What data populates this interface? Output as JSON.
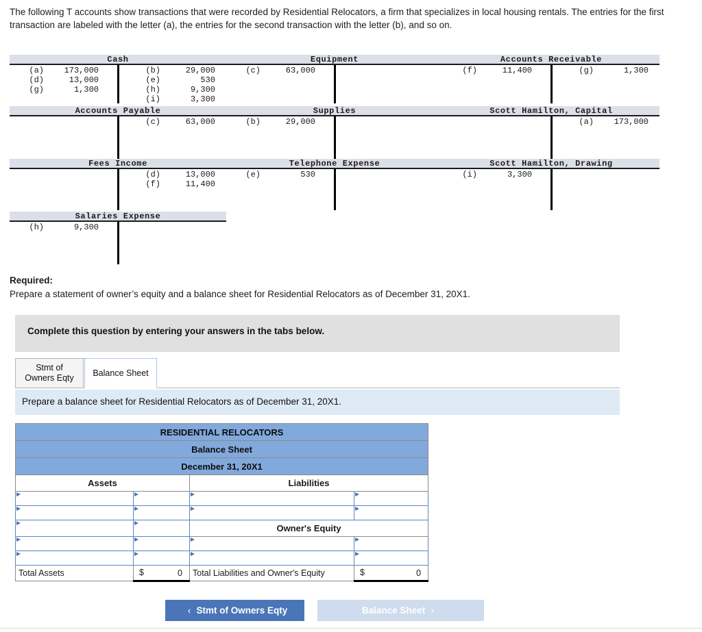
{
  "intro": {
    "text": "The following T accounts show transactions that were recorded by Residential Relocators, a firm that specializes in local housing rentals. The entries for the first transaction are labeled with the letter (a), the entries for the second transaction with the letter (b), and so on."
  },
  "t_accounts": [
    {
      "title": "Cash",
      "debits": [
        {
          "ref": "(a)",
          "amount": "173,000"
        },
        {
          "ref": "(d)",
          "amount": "13,000"
        },
        {
          "ref": "(g)",
          "amount": "1,300"
        }
      ],
      "credits": [
        {
          "ref": "(b)",
          "amount": "29,000"
        },
        {
          "ref": "(e)",
          "amount": "530"
        },
        {
          "ref": "(h)",
          "amount": "9,300"
        },
        {
          "ref": "(i)",
          "amount": "3,300"
        }
      ]
    },
    {
      "title": "Equipment",
      "debits": [
        {
          "ref": "(c)",
          "amount": "63,000"
        }
      ],
      "credits": []
    },
    {
      "title": "Accounts Receivable",
      "debits": [
        {
          "ref": "(f)",
          "amount": "11,400"
        }
      ],
      "credits": [
        {
          "ref": "(g)",
          "amount": "1,300"
        }
      ]
    },
    {
      "title": "Accounts Payable",
      "debits": [],
      "credits": [
        {
          "ref": "(c)",
          "amount": "63,000"
        }
      ]
    },
    {
      "title": "Supplies",
      "debits": [
        {
          "ref": "(b)",
          "amount": "29,000"
        }
      ],
      "credits": []
    },
    {
      "title": "Scott Hamilton, Capital",
      "debits": [],
      "credits": [
        {
          "ref": "(a)",
          "amount": "173,000"
        }
      ]
    },
    {
      "title": "Fees Income",
      "debits": [],
      "credits": [
        {
          "ref": "(d)",
          "amount": "13,000"
        },
        {
          "ref": "(f)",
          "amount": "11,400"
        }
      ]
    },
    {
      "title": "Telephone Expense",
      "debits": [
        {
          "ref": "(e)",
          "amount": "530"
        }
      ],
      "credits": []
    },
    {
      "title": "Scott Hamilton, Drawing",
      "debits": [
        {
          "ref": "(i)",
          "amount": "3,300"
        }
      ],
      "credits": []
    },
    {
      "title": "Salaries Expense",
      "debits": [
        {
          "ref": "(h)",
          "amount": "9,300"
        }
      ],
      "credits": []
    }
  ],
  "required": {
    "label": "Required:",
    "text": "Prepare a statement of owner’s equity and a balance sheet for Residential Relocators as of December 31, 20X1."
  },
  "banner": {
    "text": "Complete this question by entering your answers in the tabs below."
  },
  "tabs": [
    {
      "label": "Stmt of\nOwners Eqty",
      "line1": "Stmt of",
      "line2": "Owners Eqty",
      "active": false
    },
    {
      "label": "Balance Sheet",
      "line1": "Balance Sheet",
      "line2": "",
      "active": true
    }
  ],
  "instruction": {
    "text": "Prepare a balance sheet for Residential Relocators as of December 31, 20X1."
  },
  "balance_sheet": {
    "company": "RESIDENTIAL RELOCATORS",
    "statement": "Balance Sheet",
    "date": "December 31, 20X1",
    "col_assets": "Assets",
    "col_liabilities": "Liabilities",
    "section_owners_equity": "Owner's Equity",
    "input_placeholder": "",
    "rows": [
      {
        "left_label": "",
        "left_amount": "",
        "right_label": "",
        "right_amount": "",
        "right_is_section": false
      },
      {
        "left_label": "",
        "left_amount": "",
        "right_label": "",
        "right_amount": "",
        "right_is_section": false
      },
      {
        "left_label": "",
        "left_amount": "",
        "right_label": "Owner's Equity",
        "right_amount": "",
        "right_is_section": true
      },
      {
        "left_label": "",
        "left_amount": "",
        "right_label": "",
        "right_amount": "",
        "right_is_section": false
      },
      {
        "left_label": "",
        "left_amount": "",
        "right_label": "",
        "right_amount": "",
        "right_is_section": false
      }
    ],
    "total_left_label": "Total Assets",
    "total_left_currency": "$",
    "total_left_amount": "0",
    "total_right_label": "Total Liabilities and Owner's Equity",
    "total_right_currency": "$",
    "total_right_amount": "0"
  },
  "footer_nav": {
    "prev_label": "Stmt of Owners Eqty",
    "prev_chevron": "‹",
    "next_label": "Balance Sheet",
    "next_chevron": "›"
  },
  "colors": {
    "header_blue": "#82a9dc",
    "instruction_blue": "#dfeaf7",
    "button_blue": "#4a76b8",
    "button_disabled": "#cfdcee",
    "banner_gray": "#e0e0e0",
    "taccount_header": "#dcdfe8"
  }
}
